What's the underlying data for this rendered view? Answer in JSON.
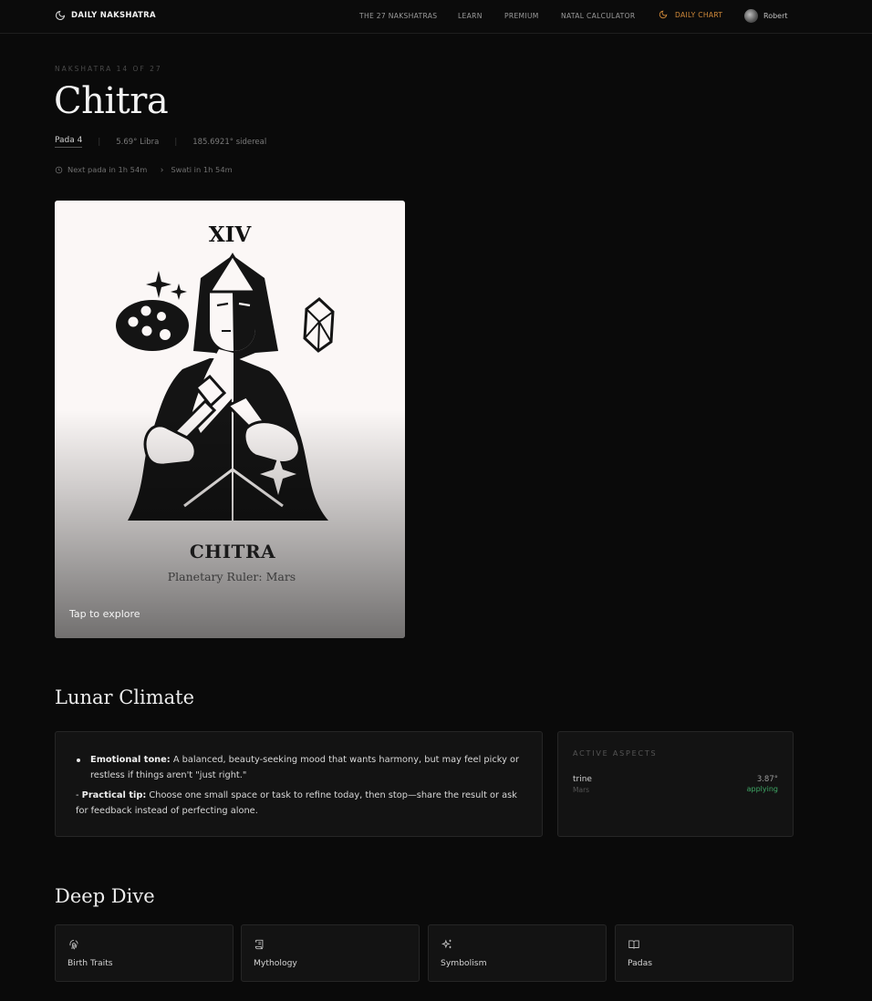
{
  "nav": {
    "brand": "DAILY NAKSHATRA",
    "links": [
      "THE 27 NAKSHATRAS",
      "LEARN",
      "PREMIUM",
      "NATAL CALCULATOR"
    ],
    "daily_chart": "DAILY CHART",
    "user_name": "Robert",
    "accent_color": "#d18a3a"
  },
  "header": {
    "eyebrow": "NAKSHATRA 14 OF 27",
    "title": "Chitra",
    "pada": "Pada 4",
    "position": "5.69° Libra",
    "sidereal": "185.6921° sidereal",
    "next_pada": "Next pada in 1h 54m",
    "next_nakshatra": "Swati in 1h 54m"
  },
  "card": {
    "roman": "XIV",
    "name": "CHITRA",
    "ruler": "Planetary Ruler: Mars",
    "cta": "Tap to explore"
  },
  "lunar_climate": {
    "heading": "Lunar Climate",
    "emotional_label": "Emotional tone:",
    "emotional_text": "A balanced, beauty-seeking mood that wants harmony, but may feel picky or restless if things aren't \"just right.\"",
    "tip_prefix": "- ",
    "tip_label": "Practical tip:",
    "tip_text": "Choose one small space or task to refine today, then stop—share the result or ask for feedback instead of perfecting alone."
  },
  "aspects": {
    "heading": "ACTIVE ASPECTS",
    "items": [
      {
        "aspect": "trine",
        "planet": "Mars",
        "degree": "3.87°",
        "state": "applying",
        "state_color": "#3fa866"
      }
    ]
  },
  "deep_dive": {
    "heading": "Deep Dive",
    "cards": [
      {
        "label": "Birth Traits",
        "icon": "fingerprint-icon"
      },
      {
        "label": "Mythology",
        "icon": "scroll-icon"
      },
      {
        "label": "Symbolism",
        "icon": "sparkles-icon"
      },
      {
        "label": "Padas",
        "icon": "book-open-icon"
      }
    ]
  }
}
